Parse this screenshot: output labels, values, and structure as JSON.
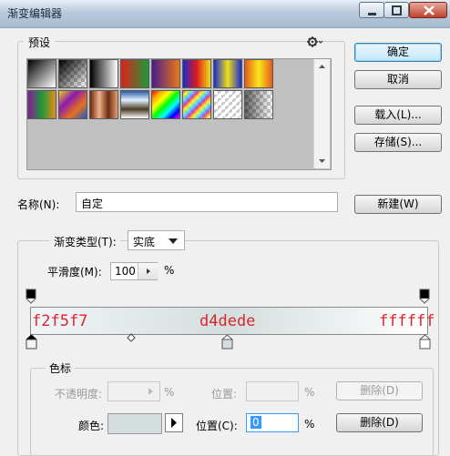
{
  "window": {
    "title": "渐变编辑器"
  },
  "buttons": {
    "ok": "确定",
    "cancel": "取消",
    "load": "载入(L)...",
    "save": "存储(S)...",
    "new": "新建(W)"
  },
  "presets": {
    "label": "预设",
    "menu_icon": "gear-icon",
    "swatches": [
      {
        "name": "black-white",
        "css": "linear-gradient(135deg,#000 0%,#fff 100%)"
      },
      {
        "name": "black-transparent",
        "css": "linear-gradient(135deg,#000 0%,rgba(0,0,0,0) 100%)"
      },
      {
        "name": "black-white-2",
        "css": "linear-gradient(to right,#000,#fff)"
      },
      {
        "name": "red-green",
        "css": "linear-gradient(to right,#e0201a,#1a9a3a)"
      },
      {
        "name": "violet-orange",
        "css": "linear-gradient(to right,#4a1a8a,#e87a1a)"
      },
      {
        "name": "blue-red-yellow",
        "css": "linear-gradient(to right,#1a2ad0,#e01a1a,#f0e01a)"
      },
      {
        "name": "blue-yellow-blue",
        "css": "linear-gradient(to right,#1a2ad0,#f0e01a,#1a2ad0)"
      },
      {
        "name": "orange-yellow-orange",
        "css": "linear-gradient(to right,#e85a1a,#f8e81a,#e85a1a)"
      },
      {
        "name": "violet-green-orange",
        "css": "linear-gradient(to right,#8a1a9a,#1a9a3a,#e88a1a)"
      },
      {
        "name": "yellow-violet-orange-blue",
        "css": "linear-gradient(135deg,#f0d01a,#8a1ab0,#e8701a,#1a5ad0)"
      },
      {
        "name": "copper",
        "css": "linear-gradient(to right,#6a2a10,#f0b08a,#6a2a10,#e8a070)"
      },
      {
        "name": "chrome",
        "css": "linear-gradient(to bottom,#2a5aa0,#e0f0ff,#4a3a20,#fff)"
      },
      {
        "name": "spectrum",
        "css": "linear-gradient(135deg,red,orange,yellow,lime,cyan,blue,magenta)"
      },
      {
        "name": "transparent-rainbow",
        "css": "repeating-linear-gradient(135deg,rgba(255,0,0,0.7) 0px,rgba(255,255,0,0.7) 4px,rgba(0,200,255,0.7) 8px,rgba(200,0,255,0.7) 12px)"
      },
      {
        "name": "transparent-stripes",
        "css": "repeating-linear-gradient(135deg,rgba(255,255,255,0.9) 0px,rgba(255,255,255,0.9) 3px,rgba(0,0,0,0) 3px,rgba(0,0,0,0) 6px)"
      },
      {
        "name": "neutral-density",
        "css": "linear-gradient(to right,rgba(0,0,0,0.6),rgba(0,0,0,0))"
      }
    ]
  },
  "name_field": {
    "label": "名称(N):",
    "value": "自定"
  },
  "gradient": {
    "type_label": "渐变类型(T):",
    "type_value": "实底",
    "smoothness_label": "平滑度(M):",
    "smoothness_value": "100",
    "smoothness_unit": "%",
    "stops": [
      "#f2f5f7",
      "#d4dede",
      "#ffffff"
    ],
    "annotations": [
      "f2f5f7",
      "d4dede",
      "ffffff"
    ]
  },
  "color_stops": {
    "label": "色标",
    "opacity_label": "不透明度:",
    "opacity_unit": "%",
    "opacity_location_label": "位置:",
    "opacity_location_unit": "%",
    "opacity_delete": "删除(D)",
    "color_label": "颜色:",
    "color_value": "#d4dede",
    "location_label": "位置(C):",
    "location_value": "0",
    "location_unit": "%",
    "color_delete": "删除(D)"
  }
}
